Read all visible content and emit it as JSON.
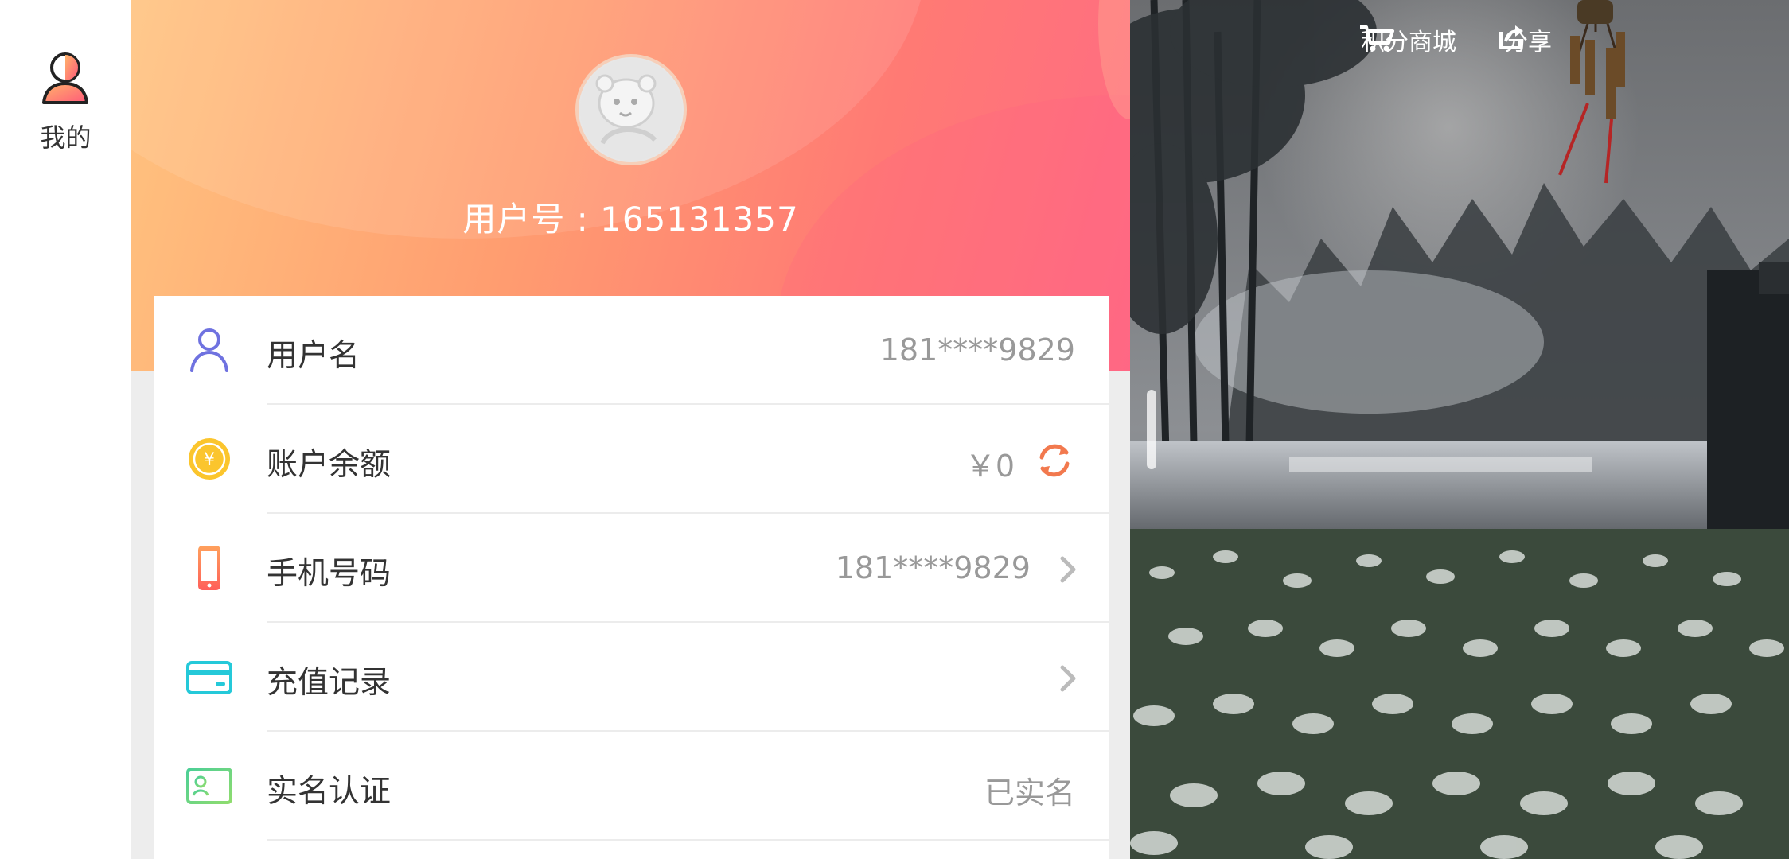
{
  "rail": {
    "tab_label": "我的"
  },
  "profile": {
    "user_id_text": "用户号 : 165131357",
    "rows": [
      {
        "label": "用户名",
        "value": "181****9829",
        "icon": "person-icon"
      },
      {
        "label": "账户余额",
        "value": "￥0",
        "icon": "coin-icon",
        "coin_symbol": "¥"
      },
      {
        "label": "手机号码",
        "value": "181****9829",
        "icon": "phone-icon"
      },
      {
        "label": "充值记录",
        "value": "",
        "icon": "card-icon"
      },
      {
        "label": "实名认证",
        "value": "已实名",
        "icon": "id-card-icon"
      }
    ]
  },
  "scene": {
    "mall_label": "积分商城",
    "share_label": "分享"
  },
  "colors": {
    "hero_start": "#ffc37f",
    "hero_end": "#ff6a84",
    "person_icon": "#6f72e0",
    "coin_icon": "#fbc52d",
    "refresh_icon": "#f2794e",
    "phone_icon": "#f77a55",
    "card_icon": "#25c9d9",
    "id_icon": "#5fd38a"
  }
}
